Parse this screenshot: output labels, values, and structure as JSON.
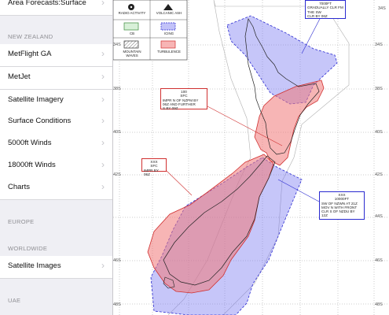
{
  "sidebar": {
    "top_item": "Area Forecasts:Surface",
    "section_nz": "NEW ZEALAND",
    "nz_items": [
      {
        "label": "MetFlight GA"
      },
      {
        "label": "MetJet"
      },
      {
        "label": "Satellite Imagery"
      },
      {
        "label": "Surface Conditions"
      },
      {
        "label": "5000ft Winds"
      },
      {
        "label": "18000ft Winds"
      },
      {
        "label": "Charts"
      }
    ],
    "section_europe": "EUROPE",
    "section_worldwide": "WORLDWIDE",
    "worldwide_items": [
      {
        "label": "Satellite Images"
      }
    ],
    "section_uae": "UAE",
    "chevron": "›"
  },
  "legend": {
    "items": [
      {
        "label": "RADIO ACTIVITY",
        "icon": "radiation-icon"
      },
      {
        "label": "VOLCANIC ASH",
        "icon": "volcano-icon"
      },
      {
        "label": "CB",
        "icon": "cb-icon"
      },
      {
        "label": "ICING",
        "icon": "icing-icon"
      },
      {
        "label": "MOUNTAIN WAVES",
        "icon": "mountain-waves-icon"
      },
      {
        "label": "TURBULENCE",
        "icon": "turbulence-icon"
      }
    ]
  },
  "latitudes": [
    "34S",
    "36S",
    "38S",
    "40S",
    "42S",
    "44S",
    "46S",
    "48S"
  ],
  "annotations": {
    "north_box": {
      "level": "7000FT",
      "lines": [
        "GRADUALLY CLR FM",
        "THE SW",
        "CLR BY 06Z"
      ]
    },
    "central_box": {
      "top": "100",
      "sfc": "SFC",
      "lines": [
        "IMPR N OF NZPM BY",
        "06Z AND FURTHER",
        "S BY 09Z"
      ]
    },
    "west_box": {
      "top": "XXX",
      "sfc": "SFC",
      "lines": [
        "IMPR BY 06Z"
      ]
    },
    "east_box": {
      "top": "XXX",
      "level": "10000FT",
      "lines": [
        "SW OF NZWN AT 21Z",
        "MOV N WITH FRONT",
        "CLR S OF NZDU BY",
        "12Z"
      ]
    }
  },
  "colors": {
    "icing": "#8e8ef0",
    "turbulence": "#f08a8a",
    "icing_border": "#2a2ad0",
    "turbulence_border": "#d03030"
  }
}
